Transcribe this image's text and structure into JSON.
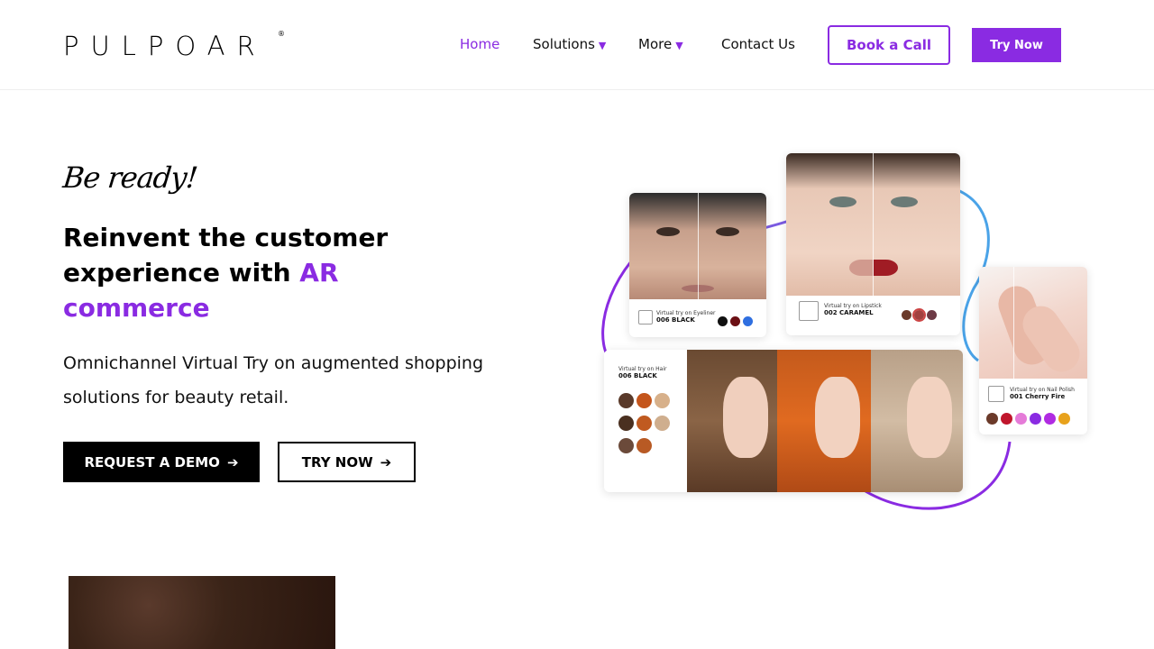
{
  "brand": {
    "logo_text": "PULPOAR",
    "registered": "®"
  },
  "nav": {
    "home": "Home",
    "solutions": "Solutions",
    "more": "More",
    "contact": "Contact Us",
    "caret": "▼",
    "book_call": "Book a Call",
    "try_now": "Try Now"
  },
  "hero": {
    "tagline": "Be ready!",
    "headline_part1": "Reinvent the customer experience with ",
    "headline_accent": "AR commerce",
    "subtext": "Omnichannel Virtual Try on augmented shopping solutions for beauty retail.",
    "request_demo": "REQUEST A DEMO",
    "try_now": "TRY NOW",
    "arrow": "➔"
  },
  "collage": {
    "eyeliner": {
      "label": "Virtual try on Eyeliner",
      "shade": "006 BLACK",
      "swatches": [
        "#111111",
        "#6b0f14",
        "#2f6fe0"
      ]
    },
    "lipstick": {
      "label": "Virtual try on Lipstick",
      "shade": "002 CARAMEL",
      "swatches": [
        "#6b3a2a",
        "#a2403f",
        "#6d3a45"
      ]
    },
    "nail": {
      "label": "Virtual try on Nail Polish",
      "shade": "001 Cherry Fire",
      "swatches": [
        "#6b3a2a",
        "#c0162c",
        "#e57bd8",
        "#8a2be2",
        "#b02be2",
        "#e8a21c"
      ]
    },
    "hair": {
      "label": "Virtual try on Hair",
      "shade": "006 BLACK",
      "swatches": [
        "#5a3a2a",
        "#c4551c",
        "#d7b08a",
        "#4a3020",
        "#c05a20",
        "#cfae8e",
        "#6b4a3a",
        "#b85a24"
      ]
    },
    "colors": {
      "accent": "#8a2be2",
      "blue": "#4aa3e8"
    }
  }
}
